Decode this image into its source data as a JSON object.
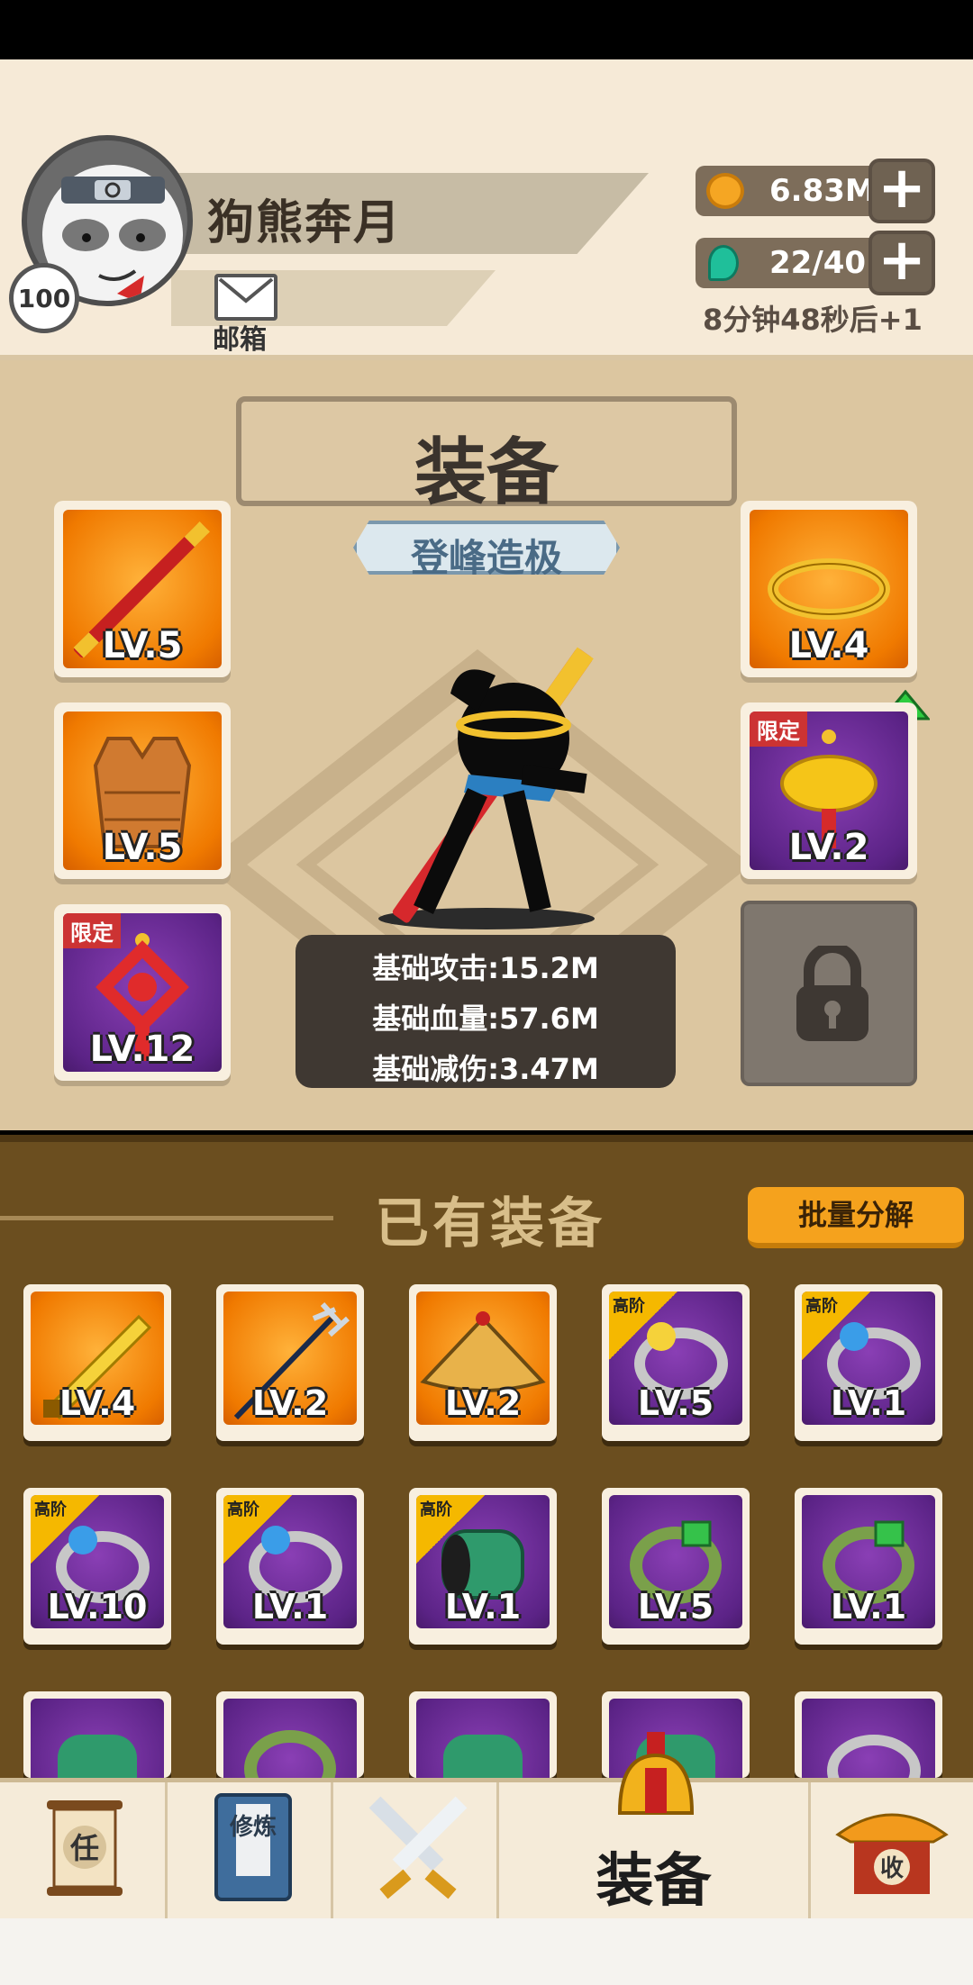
{
  "header": {
    "player_name": "狗熊奔月",
    "level": "100",
    "mail_label": "邮箱",
    "gold": "6.83M",
    "gold_plus": "+",
    "stamina": "22/40",
    "stamina_plus": "+",
    "stamina_timer": "8分钟48秒后+1"
  },
  "equipment_panel": {
    "title": "装备",
    "rank": "登峰造极",
    "slots_left": [
      {
        "level": "LV.5",
        "item": "staff",
        "rarity": "orange"
      },
      {
        "level": "LV.5",
        "item": "armor-vest",
        "rarity": "orange"
      },
      {
        "level": "LV.12",
        "item": "chinese-knot",
        "rarity": "purple",
        "tag": "限定"
      }
    ],
    "slots_right": [
      {
        "level": "LV.4",
        "item": "golden-headband",
        "rarity": "orange"
      },
      {
        "level": "LV.2",
        "item": "golden-pendant",
        "rarity": "purple",
        "tag": "限定"
      }
    ],
    "stats": [
      "基础攻击:15.2M",
      "基础血量:57.6M",
      "基础减伤:3.47M"
    ]
  },
  "inventory": {
    "title": "已有装备",
    "bulk_button": "批量分解",
    "high_tag": "高阶",
    "items": [
      {
        "level": "LV.4",
        "item": "golden-sword",
        "rarity": "orange",
        "high": false
      },
      {
        "level": "LV.2",
        "item": "trident-spear",
        "rarity": "orange",
        "high": false
      },
      {
        "level": "LV.2",
        "item": "bamboo-hat",
        "rarity": "orange",
        "high": false
      },
      {
        "level": "LV.5",
        "item": "pearl-ring-gold",
        "rarity": "purple",
        "high": true
      },
      {
        "level": "LV.1",
        "item": "pearl-ring-blue",
        "rarity": "purple",
        "high": true
      },
      {
        "level": "LV.10",
        "item": "pearl-ring-blue",
        "rarity": "purple",
        "high": true
      },
      {
        "level": "LV.1",
        "item": "pearl-ring-blue",
        "rarity": "purple",
        "high": true
      },
      {
        "level": "LV.1",
        "item": "jade-armguard",
        "rarity": "purple",
        "high": true
      },
      {
        "level": "LV.5",
        "item": "jade-bracelet",
        "rarity": "purple",
        "high": false
      },
      {
        "level": "LV.1",
        "item": "jade-bracelet",
        "rarity": "purple",
        "high": false
      }
    ]
  },
  "nav": {
    "task_icon_text": "任",
    "cultivate_icon_text": "修炼",
    "equip_label": "装备",
    "collect_icon_text": "收"
  },
  "colors": {
    "panel_bg": "#dcc6a0",
    "inventory_bg": "#6b4e1f",
    "orange_rarity": "#f07a00",
    "purple_rarity": "#5b2386",
    "accent_button": "#f5a21d"
  }
}
